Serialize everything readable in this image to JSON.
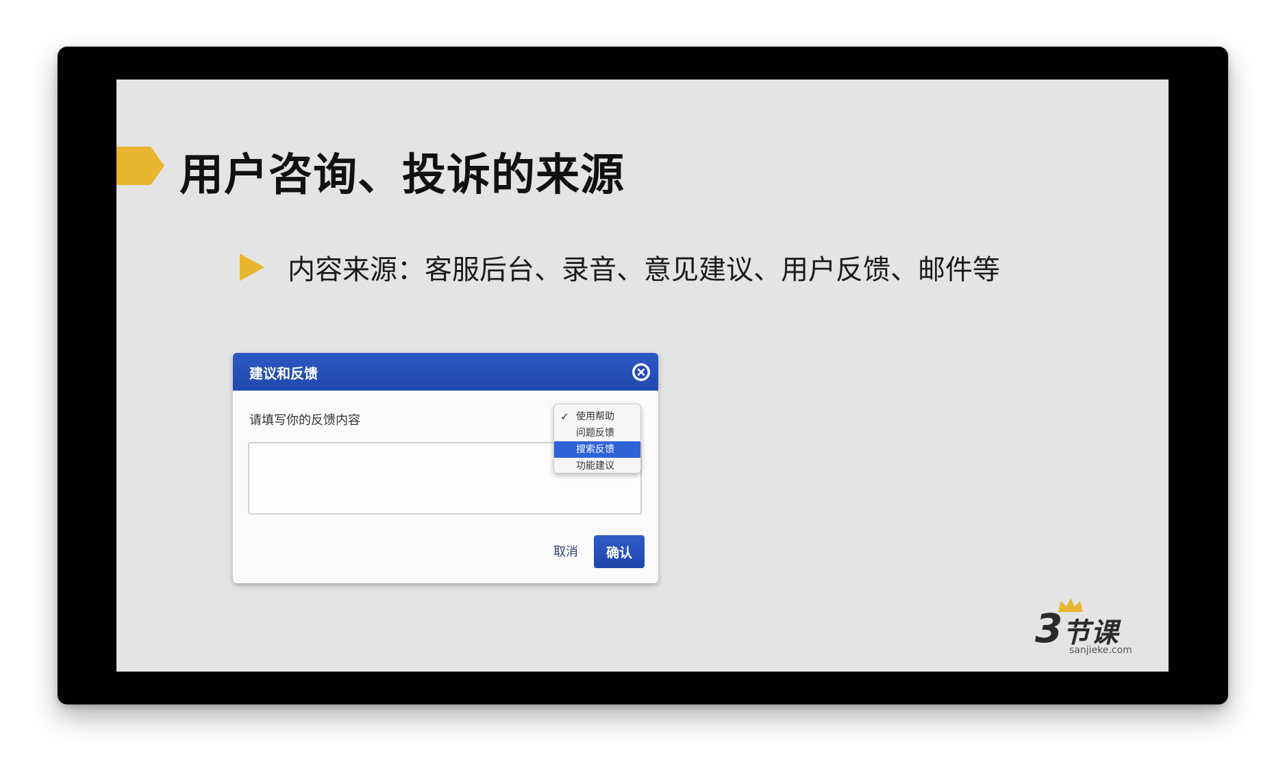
{
  "slide": {
    "title": "用户咨询、投诉的来源",
    "bullet": "内容来源：客服后台、录音、意见建议、用户反馈、邮件等"
  },
  "dialog": {
    "title": "建议和反馈",
    "prompt": "请填写你的反馈内容",
    "textarea_value": "",
    "category_options": [
      "使用帮助",
      "问题反馈",
      "搜索反馈",
      "功能建议"
    ],
    "checked_option": "使用帮助",
    "highlighted_option": "搜索反馈",
    "cancel_label": "取消",
    "confirm_label": "确认"
  },
  "logo": {
    "number": "3",
    "chars": "节课",
    "domain": "sanjieke.com"
  },
  "colors": {
    "accent_yellow": "#e8b52e",
    "dialog_blue": "#2349b0",
    "highlight_blue": "#2e63d8",
    "slide_bg": "#e4e4e4"
  },
  "icons": {
    "title_marker": "pentagon-arrow-icon",
    "bullet": "triangle-bullet-icon",
    "close": "close-circle-icon",
    "check": "check-icon",
    "crown": "crown-icon"
  }
}
